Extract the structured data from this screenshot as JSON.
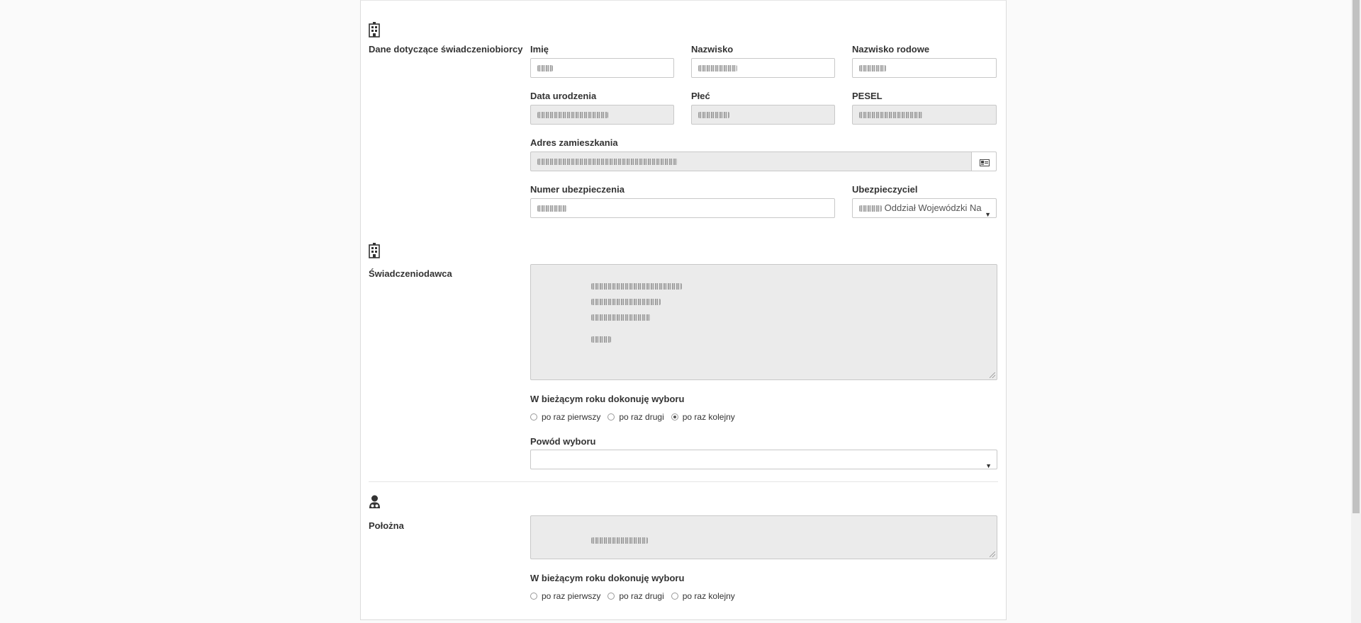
{
  "beneficiary": {
    "section_label": "Dane dotyczące świadczeniobiorcy",
    "first_name_label": "Imię",
    "last_name_label": "Nazwisko",
    "maiden_name_label": "Nazwisko rodowe",
    "birth_date_label": "Data urodzenia",
    "sex_label": "Płeć",
    "pesel_label": "PESEL",
    "address_label": "Adres zamieszkania",
    "insurance_number_label": "Numer ubezpieczenia",
    "insurer_label": "Ubezpieczyciel",
    "insurer_value": "Oddział Wojewódzki Na"
  },
  "provider": {
    "section_label": "Świadczeniodawca",
    "choice_label": "W bieżącym roku dokonuję wyboru",
    "options": [
      "po raz pierwszy",
      "po raz drugi",
      "po raz kolejny"
    ],
    "selected_option": "po raz kolejny",
    "reason_label": "Powód wyboru",
    "reason_value": ""
  },
  "midwife": {
    "section_label": "Położna",
    "choice_label": "W bieżącym roku dokonuję wyboru",
    "options": [
      "po raz pierwszy",
      "po raz drugi",
      "po raz kolejny"
    ],
    "selected_option": ""
  },
  "icons": {
    "beneficiary": "building-icon",
    "provider": "building-icon",
    "midwife": "midwife-icon",
    "address_addon": "id-card-icon",
    "select": "caret-down-icon"
  }
}
